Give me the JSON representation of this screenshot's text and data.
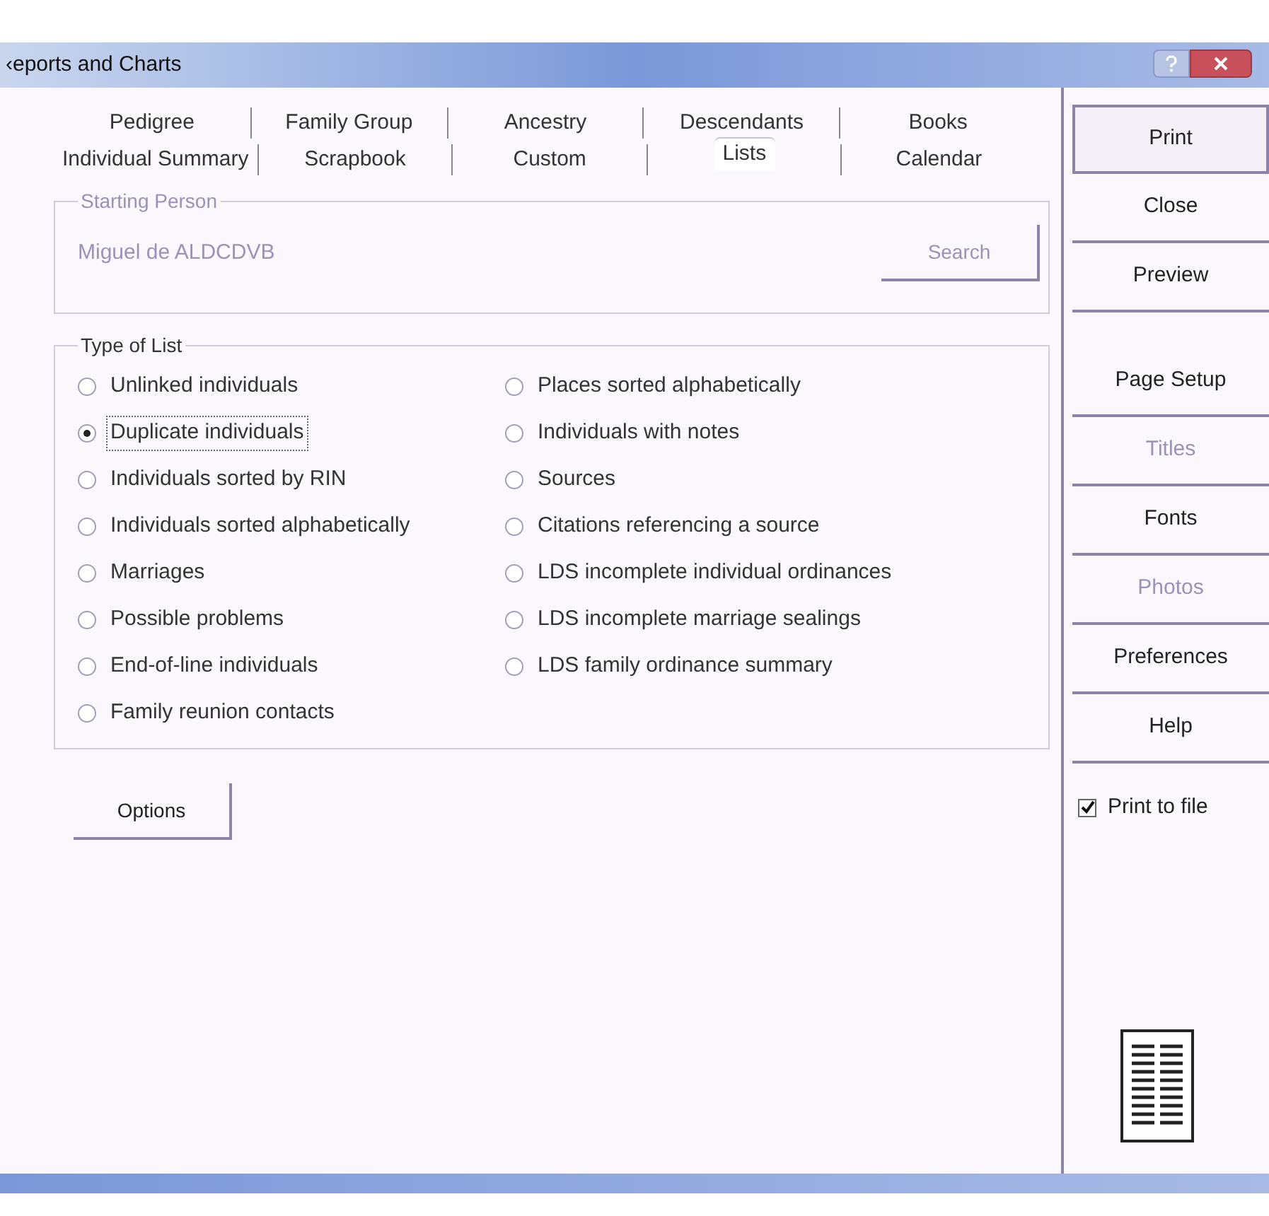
{
  "window": {
    "title": "‹eports and Charts"
  },
  "tab_rows": [
    [
      {
        "label": "Pedigree",
        "selected": false
      },
      {
        "label": "Family Group",
        "selected": false
      },
      {
        "label": "Ancestry",
        "selected": false
      },
      {
        "label": "Descendants",
        "selected": false
      },
      {
        "label": "Books",
        "selected": false
      }
    ],
    [
      {
        "label": "Individual Summary",
        "selected": false
      },
      {
        "label": "Scrapbook",
        "selected": false
      },
      {
        "label": "Custom",
        "selected": false
      },
      {
        "label": "Lists",
        "selected": true
      },
      {
        "label": "Calendar",
        "selected": false
      }
    ]
  ],
  "starting_person": {
    "title": "Starting Person",
    "value": "Miguel de ALDCDVB",
    "disabled": true,
    "search_button": {
      "label": "Search",
      "disabled": true
    }
  },
  "type_of_list": {
    "title": "Type of List",
    "columns": [
      [
        {
          "label": "Unlinked individuals",
          "selected": false
        },
        {
          "label": "Duplicate individuals",
          "selected": true
        },
        {
          "label": "Individuals sorted by RIN",
          "selected": false
        },
        {
          "label": "Individuals sorted alphabetically",
          "selected": false
        },
        {
          "label": "Marriages",
          "selected": false
        },
        {
          "label": "Possible problems",
          "selected": false
        },
        {
          "label": "End-of-line individuals",
          "selected": false
        },
        {
          "label": "Family reunion contacts",
          "selected": false
        }
      ],
      [
        {
          "label": "Places sorted alphabetically",
          "selected": false
        },
        {
          "label": "Individuals with notes",
          "selected": false
        },
        {
          "label": "Sources",
          "selected": false
        },
        {
          "label": "Citations referencing a source",
          "selected": false
        },
        {
          "label": "LDS incomplete individual ordinances",
          "selected": false
        },
        {
          "label": "LDS incomplete marriage sealings",
          "selected": false
        },
        {
          "label": "LDS family ordinance summary",
          "selected": false
        }
      ]
    ]
  },
  "options_button": {
    "label": "Options"
  },
  "side_buttons": [
    {
      "label": "Print",
      "disabled": false,
      "gap_before": false
    },
    {
      "label": "Close",
      "disabled": false,
      "gap_before": false
    },
    {
      "label": "Preview",
      "disabled": false,
      "gap_before": false
    },
    {
      "label": "Page Setup",
      "disabled": false,
      "gap_before": true
    },
    {
      "label": "Titles",
      "disabled": true,
      "gap_before": false
    },
    {
      "label": "Fonts",
      "disabled": false,
      "gap_before": false
    },
    {
      "label": "Photos",
      "disabled": true,
      "gap_before": false
    },
    {
      "label": "Preferences",
      "disabled": false,
      "gap_before": false
    },
    {
      "label": "Help",
      "disabled": false,
      "gap_before": false
    }
  ],
  "print_to_file": {
    "label": "Print to file",
    "checked": true
  }
}
